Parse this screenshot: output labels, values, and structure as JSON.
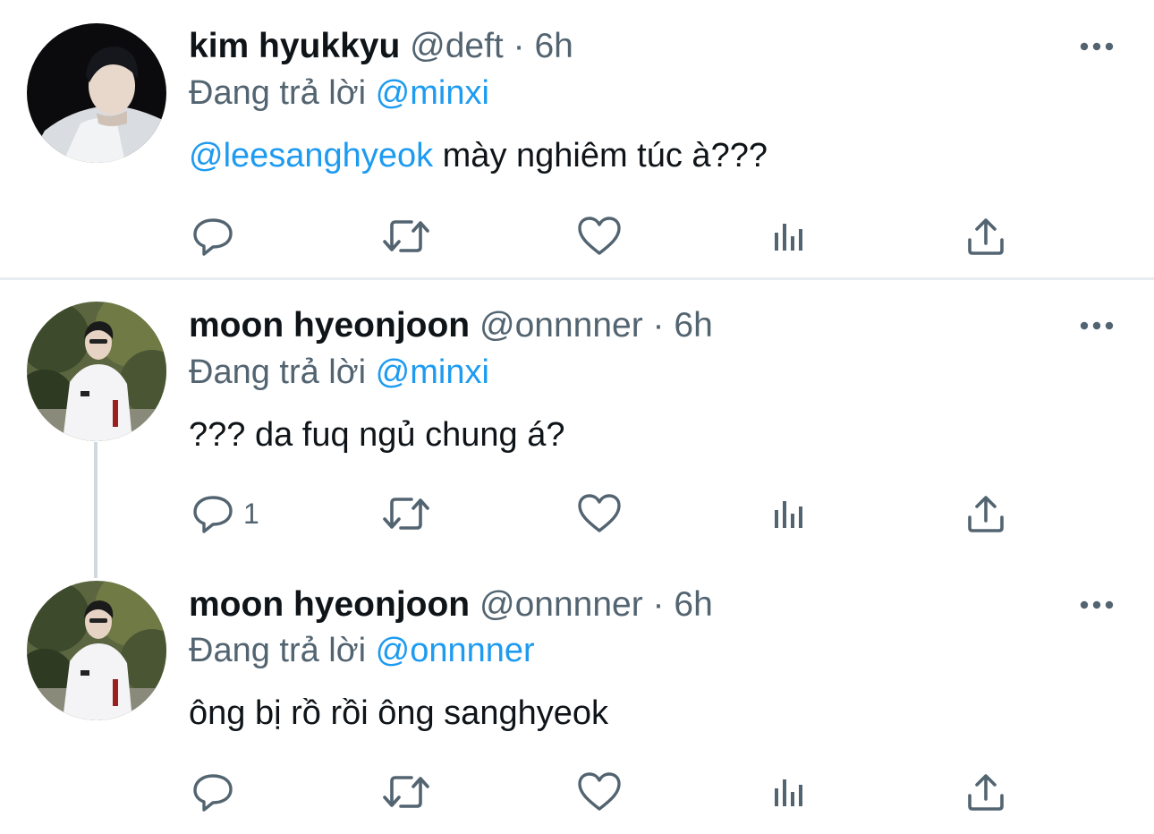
{
  "tweets": [
    {
      "name": "kim hyukkyu",
      "handle": "@deft",
      "separator": "·",
      "time": "6h",
      "reply_prefix": "Đang trả lời",
      "reply_to": "@minxi",
      "body_mention": "@leesanghyeok",
      "body_text": " mày nghiêm túc à???",
      "reply_count": "",
      "avatar_icon": "avatar-dark-portrait"
    },
    {
      "name": "moon hyeonjoon",
      "handle": "@onnnner",
      "separator": "·",
      "time": "6h",
      "reply_prefix": "Đang trả lời",
      "reply_to": "@minxi",
      "body_mention": "",
      "body_text": "??? da fuq ngủ chung á?",
      "reply_count": "1",
      "avatar_icon": "avatar-outdoor-portrait"
    },
    {
      "name": "moon hyeonjoon",
      "handle": "@onnnner",
      "separator": "·",
      "time": "6h",
      "reply_prefix": "Đang trả lời",
      "reply_to": "@onnnner",
      "body_mention": "",
      "body_text": "ông bị rồ rồi ông sanghyeok",
      "reply_count": "",
      "avatar_icon": "avatar-outdoor-portrait"
    }
  ],
  "icons": {
    "more": "more-dots-icon",
    "reply": "reply-bubble-icon",
    "retweet": "retweet-icon",
    "like": "heart-icon",
    "analytics": "analytics-bars-icon",
    "share": "share-upload-icon"
  },
  "colors": {
    "accent": "#1d9bf0",
    "secondary_text": "#536471",
    "primary_text": "#0f1419",
    "divider": "#e6ecf0"
  }
}
